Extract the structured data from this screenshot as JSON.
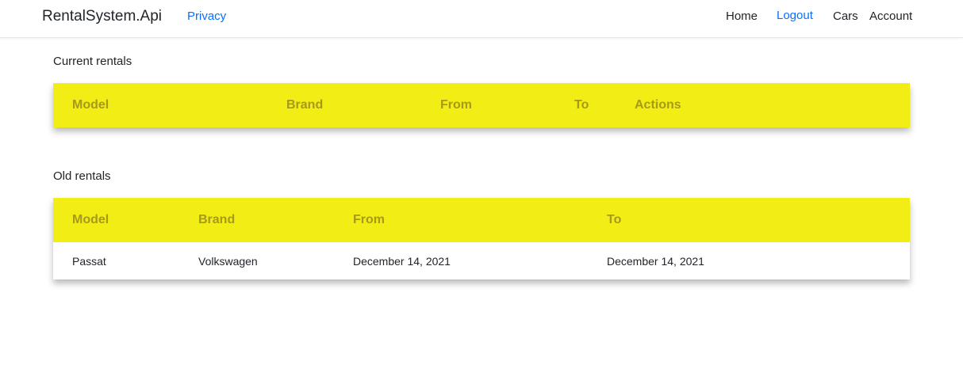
{
  "navbar": {
    "brand": "RentalSystem.Api",
    "privacy": "Privacy",
    "home": "Home",
    "logout": "Logout",
    "cars": "Cars",
    "account": "Account"
  },
  "colors": {
    "table_header_bg": "#f2ed14",
    "table_header_text": "#a69a1a",
    "link": "#0d6efd"
  },
  "current_rentals": {
    "title": "Current rentals",
    "headers": [
      "Model",
      "Brand",
      "From",
      "To",
      "Actions"
    ],
    "rows": []
  },
  "old_rentals": {
    "title": "Old rentals",
    "headers": [
      "Model",
      "Brand",
      "From",
      "To"
    ],
    "rows": [
      [
        "Passat",
        "Volkswagen",
        "December 14, 2021",
        "December 14, 2021"
      ]
    ]
  }
}
